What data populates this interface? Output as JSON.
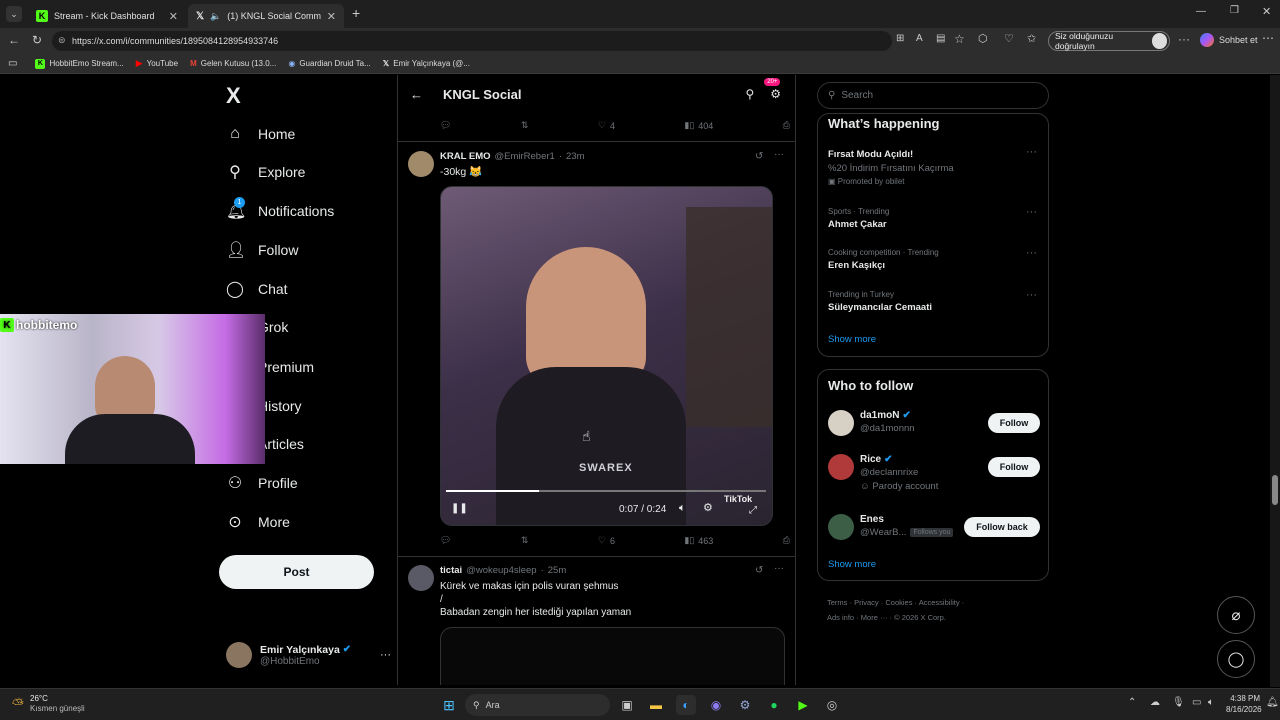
{
  "browser": {
    "tabs": [
      {
        "title": "Stream - Kick Dashboard"
      },
      {
        "title": "(1) KNGL Social Community /"
      }
    ],
    "url": "https://x.com/i/communities/1895084128954933746",
    "verify_label": "Siz olduğunuzu doğrulayın",
    "chat_label": "Sohbet et",
    "bookmarks": [
      "HobbitEmo Stream...",
      "YouTube",
      "Gelen Kutusu (13.0...",
      "Guardian Druid Ta...",
      "Emir Yalçınkaya (@..."
    ]
  },
  "sidebar": {
    "logo": "X",
    "items": [
      {
        "label": "Home",
        "icon": "home-icon"
      },
      {
        "label": "Explore",
        "icon": "search-icon"
      },
      {
        "label": "Notifications",
        "icon": "bell-icon"
      },
      {
        "label": "Follow",
        "icon": "add-person-icon"
      },
      {
        "label": "Chat",
        "icon": "chat-icon"
      },
      {
        "label": "Grok",
        "icon": "grok-icon"
      },
      {
        "label": "Premium",
        "icon": "x-icon"
      },
      {
        "label": "History",
        "icon": "history-icon"
      },
      {
        "label": "Articles",
        "icon": "articles-icon"
      },
      {
        "label": "Profile",
        "icon": "person-icon"
      },
      {
        "label": "More",
        "icon": "more-icon"
      }
    ],
    "notif_badge": "1",
    "post_label": "Post",
    "account": {
      "name": "Emir Yalçınkaya",
      "handle": "@HobbitEmo"
    }
  },
  "overlay": {
    "streamer": "hobbitemo"
  },
  "feed": {
    "header_title": "KNGL Social",
    "badge": "20+",
    "prev_actions": {
      "likes": "4",
      "views": "404"
    },
    "post1": {
      "name": "KRAL EMO",
      "handle": "@EmirReber1",
      "time": "23m",
      "text": "-30kg 😹",
      "video": {
        "time": "0:07 / 0:24",
        "watermark": "SWAREX",
        "tiktok": "TikTok",
        "progress": 0.29
      },
      "likes": "6",
      "views": "463"
    },
    "post2": {
      "name": "tictai",
      "handle": "@wokeup4sleep",
      "time": "25m",
      "line1": "Kürek ve makas için polis vuran şehmus",
      "line2": "/",
      "line3": "Babadan zengin her istediği yapılan yaman"
    }
  },
  "right": {
    "search_placeholder": "Search",
    "happening_title": "What’s happening",
    "promo": {
      "title": "Fırsat Modu Açıldı!",
      "desc": "%20 İndirim Fırsatını Kaçırma",
      "promoted": "Promoted by obilet"
    },
    "trends": [
      {
        "meta": "Sports · Trending",
        "title": "Ahmet Çakar"
      },
      {
        "meta": "Cooking competition · Trending",
        "title": "Eren Kaşıkçı"
      },
      {
        "meta": "Trending in Turkey",
        "title": "Süleymancılar Cemaati"
      }
    ],
    "show_more": "Show more",
    "wtf_title": "Who to follow",
    "follow": [
      {
        "name": "da1moN",
        "handle": "@da1monnn",
        "button": "Follow"
      },
      {
        "name": "Rice",
        "handle": "@declannrixe",
        "note": "Parody account",
        "button": "Follow"
      },
      {
        "name": "Enes",
        "handle": "@WearB...",
        "note": "Follows you",
        "button": "Follow back"
      }
    ],
    "footer": [
      "Terms",
      "Privacy",
      "Cookies",
      "Accessibility",
      "Ads info",
      "More ···",
      "© 2026 X Corp."
    ]
  },
  "taskbar": {
    "weather_temp": "26°C",
    "weather_desc": "Kısmen güneşli",
    "search": "Ara",
    "time": "4:38 PM",
    "date": "8/16/2026"
  }
}
